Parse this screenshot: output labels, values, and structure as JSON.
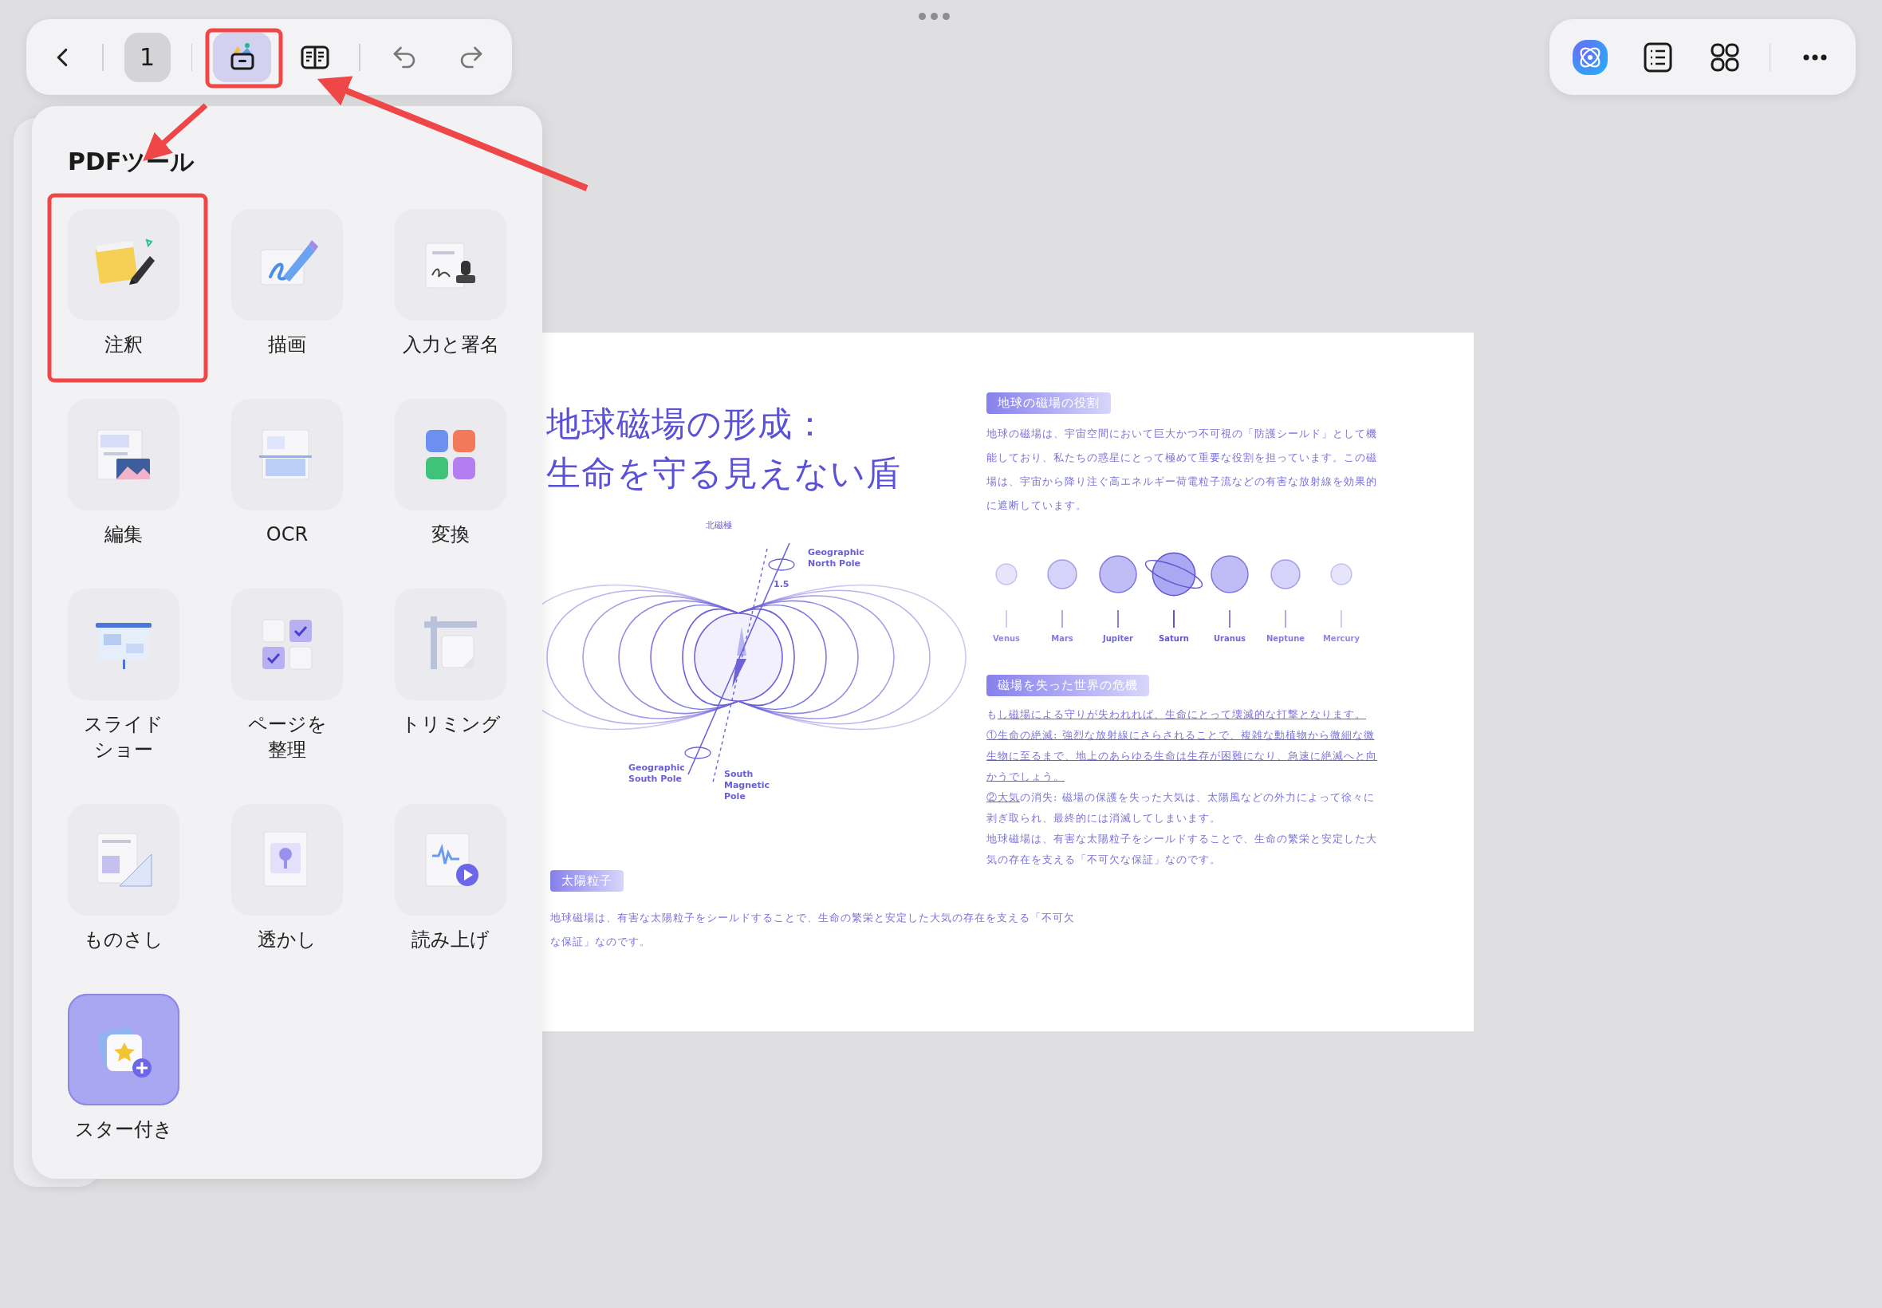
{
  "toolbar": {
    "page_number": "1",
    "buttons": [
      {
        "kind": "tools",
        "selected": true
      },
      {
        "kind": "reader",
        "selected": false
      }
    ]
  },
  "panel": {
    "title": "PDFツール",
    "tools": [
      {
        "label": "注釈",
        "kind": "tool"
      },
      {
        "label": "描画",
        "kind": "tool"
      },
      {
        "label": "入力と署名",
        "kind": "tool"
      },
      {
        "label": "編集",
        "kind": "tool"
      },
      {
        "label": "OCR",
        "kind": "tool"
      },
      {
        "label": "変換",
        "kind": "tool"
      },
      {
        "label": "スライドショー",
        "kind": "tool"
      },
      {
        "label": "ページを整理",
        "kind": "tool"
      },
      {
        "label": "トリミング",
        "kind": "tool"
      },
      {
        "label": "ものさし",
        "kind": "tool"
      },
      {
        "label": "透かし",
        "kind": "tool"
      },
      {
        "label": "読み上げ",
        "kind": "tool"
      },
      {
        "label": "スター付き",
        "kind": "favorite"
      }
    ]
  },
  "document": {
    "title_lines": [
      "地球磁場の形成：",
      "生命を守る見えない盾"
    ],
    "diagram_labels": {
      "north_magnetic": "北磁極",
      "geo_north": "Geographic\nNorth Pole",
      "angle": "1.5",
      "geo_south": "Geographic\nSouth Pole",
      "south_magnetic": "South\nMagnetic\nPole"
    },
    "role_section": {
      "heading": "地球の磁場の役割",
      "text": "地球の磁場は、宇宙空間において巨大かつ不可視の「防護シールド」として機能しており、私たちの惑星にとって極めて重要な役割を担っています。この磁場は、宇宙から降り注ぐ高エネルギー荷電粒子流などの有害な放射線を効果的に遮断しています。"
    },
    "planets": [
      {
        "name": "Venus",
        "kind": "plain"
      },
      {
        "name": "Mars",
        "kind": "plain"
      },
      {
        "name": "Jupiter",
        "kind": "plain"
      },
      {
        "name": "Saturn",
        "kind": "ringed"
      },
      {
        "name": "Uranus",
        "kind": "plain"
      },
      {
        "name": "Neptune",
        "kind": "plain"
      },
      {
        "name": "Mercury",
        "kind": "plain"
      }
    ],
    "crisis_section": {
      "heading": "磁場を失った世界の危機",
      "paragraphs": [
        {
          "segments": [
            {
              "text": "も",
              "underlined": false
            },
            {
              "text": "し磁場による守りが失われれば、生命にとって壊滅的な打撃となります。",
              "underlined": true
            }
          ]
        },
        {
          "segments": [
            {
              "text": "①生命の絶滅: 強烈な放射線にさらされることで、複雑な動植物から微細な微生物に至るまで、地上のあらゆる生命は生存が困難になり、急速に絶滅へと向かうでしょう。",
              "underlined": true
            }
          ]
        },
        {
          "segments": [
            {
              "text": "②大気",
              "underlined": true
            },
            {
              "text": "の消失: 磁場の保護を失った大気は、太陽風などの外力によって徐々に剥ぎ取られ、最終的には消滅してしまいます。",
              "underlined": false
            }
          ]
        },
        {
          "segments": [
            {
              "text": "地球磁場は、有害な太陽粒子をシールドすることで、生命の繁栄と安定した大気の存在を支える「不可欠な保証」なのです。",
              "underlined": false
            }
          ]
        }
      ]
    },
    "solar_section": {
      "heading": "太陽粒子",
      "text": "地球磁場は、有害な太陽粒子をシールドすることで、生命の繁栄と安定した大気の存在を支える「不可欠な保証」なのです。"
    }
  }
}
